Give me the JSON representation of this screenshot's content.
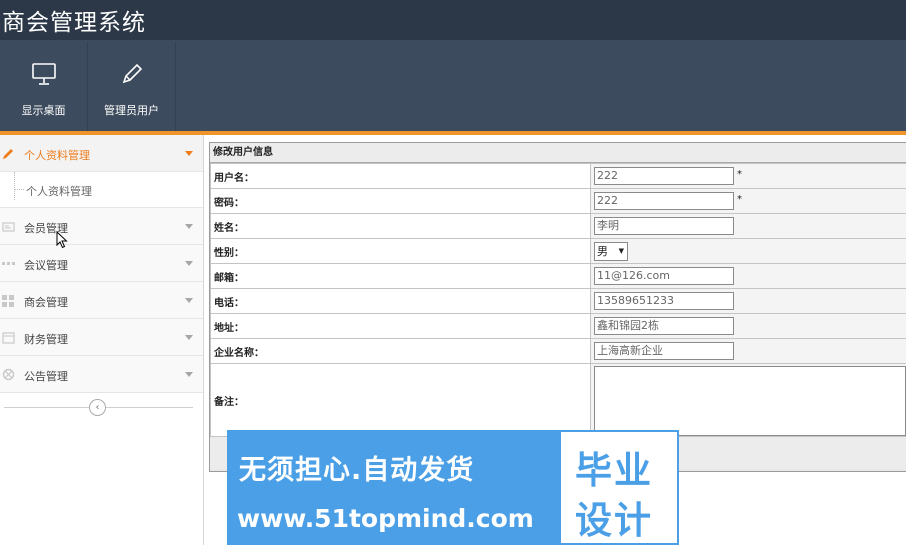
{
  "app": {
    "title": "商会管理系统"
  },
  "toolbar": {
    "buttons": [
      {
        "label": "显示桌面",
        "icon": "monitor-icon"
      },
      {
        "label": "管理员用户",
        "icon": "pencil-icon"
      }
    ]
  },
  "sidebar": {
    "items": [
      {
        "label": "个人资料管理",
        "icon": "pencil-icon",
        "active": true,
        "children": [
          {
            "label": "个人资料管理"
          }
        ]
      },
      {
        "label": "会员管理",
        "icon": "member-icon"
      },
      {
        "label": "会议管理",
        "icon": "meeting-icon"
      },
      {
        "label": "商会管理",
        "icon": "grid-icon"
      },
      {
        "label": "财务管理",
        "icon": "calendar-icon"
      },
      {
        "label": "公告管理",
        "icon": "notice-icon"
      }
    ]
  },
  "form": {
    "title": "修改用户信息",
    "fields": {
      "username": {
        "label": "用户名：",
        "value": "222",
        "required": "*"
      },
      "password": {
        "label": "密码：",
        "value": "222",
        "required": "*"
      },
      "name": {
        "label": "姓名：",
        "value": "李明"
      },
      "gender": {
        "label": "性别：",
        "value": "男"
      },
      "email": {
        "label": "邮箱：",
        "value": "11@126.com"
      },
      "phone": {
        "label": "电话：",
        "value": "13589651233"
      },
      "address": {
        "label": "地址：",
        "value": "鑫和锦园2栋"
      },
      "company": {
        "label": "企业名称：",
        "value": "上海高新企业"
      },
      "remark": {
        "label": "备注：",
        "value": ""
      }
    }
  },
  "watermark": {
    "line1": "无须担心.自动发货",
    "line2": "www.51topmind.com",
    "box_line1": "毕业",
    "box_line2": "设计"
  },
  "colors": {
    "header": "#3d4b5e",
    "accent": "#f0932b",
    "active_text": "#f07c1c",
    "watermark": "#4b9fe6"
  }
}
